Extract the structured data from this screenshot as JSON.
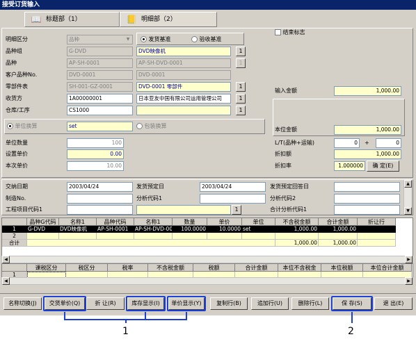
{
  "window": {
    "title": "接受订货输入"
  },
  "tabs": [
    {
      "label": "标题部（1）",
      "icon": "book-icon"
    },
    {
      "label": "明细部（2）",
      "icon": "notebook-icon"
    }
  ],
  "header": {
    "detail_type_label": "明细区分",
    "detail_type_value": "品种",
    "basis_option1": "发货基准",
    "basis_option2": "验收基准",
    "end_flag_label": "结束标志",
    "group_label": "品种组",
    "group_code": "G-DVD",
    "group_name": "DVD映像机",
    "item_label": "品种",
    "item_code": "AP-SH-0001",
    "item_name": "AP-SH-DVD-0001",
    "cust_item_label": "客户品种No.",
    "cust_item_code": "DVD-0001",
    "cust_item_name": "DVD-0001",
    "parts_label": "零部件表",
    "parts_code": "SH-001-GZ-0001",
    "parts_name": "DVD-0001 零部件",
    "receiver_label": "收货方",
    "receiver_code": "1A00000001",
    "receiver_name": "日本亚友中国有限公司运用管理公司",
    "warehouse_label": "仓库/工序",
    "warehouse_code": "CS1000",
    "warehouse_name": "",
    "input_amount_label": "输入金额",
    "input_amount": "1,000.00",
    "local_amount_label": "本位金额",
    "local_amount": "1,000.00",
    "unit_conv_label": "单位换算",
    "unit_conv_value": "set",
    "pack_conv_label": "包装换算",
    "unit_qty_label": "单位数量",
    "unit_qty": "100",
    "set_price_label": "设置单价",
    "set_price": "0.00",
    "this_price_label": "本次单价",
    "this_price": "10.00",
    "lt_label": "L/T(品种+运输)",
    "lt_value1": "0",
    "lt_plus": "+",
    "lt_value2": "0",
    "discount_label": "折扣额",
    "discount_value": "1,000.00",
    "discount_rate_label": "折扣率",
    "discount_rate_value": "1.000000",
    "confirm_button": "确 定(E)"
  },
  "delivery": {
    "delivery_date_label": "交纳日期",
    "delivery_date": "2003/04/24",
    "ship_date_label": "发货预定日",
    "ship_date": "2003/04/24",
    "ship_answer_label": "发货预定回答日",
    "ship_answer": "",
    "mfg_no_label": "制造No.",
    "mfg_no": "",
    "analysis1_label": "分析代码1",
    "analysis1": "",
    "analysis2_label": "分析代码2",
    "analysis2": "",
    "project_label": "工程项目代码1",
    "project": "",
    "project_name": "",
    "total_analysis_label": "合计分析代码1",
    "total_analysis": ""
  },
  "detail_grid": {
    "columns": [
      "品种G代码",
      "名称1",
      "品种代码",
      "名称1",
      "数量",
      "单价",
      "单位",
      "不含税金额",
      "合计金额",
      "折让行"
    ],
    "rows": [
      {
        "no": "1",
        "cells": [
          "G-DVD",
          "DVD映像机",
          "AP-SH-0001",
          "AP-SH-DVD-000",
          "100.0000",
          "10.0000",
          "set",
          "1,000.00",
          "1,000.00",
          ""
        ]
      },
      {
        "no": "2",
        "cells": [
          "",
          "",
          "",
          "",
          "",
          "",
          "",
          "",
          "",
          ""
        ]
      }
    ],
    "total_label": "合计",
    "total_excl": "1,000.00",
    "total_amount": "1,000.00"
  },
  "tax_grid": {
    "columns": [
      "课税区分",
      "税区分",
      "税率",
      "不含税金额",
      "税额",
      "合计金额",
      "本位不含税金",
      "本位税额",
      "本位合计金额"
    ],
    "rows": [
      {
        "no": "1",
        "cells": [
          "",
          "",
          "",
          "",
          "",
          "",
          "",
          "",
          ""
        ]
      }
    ]
  },
  "footer_buttons": [
    {
      "label": "名称切换(J)"
    },
    {
      "label": "交货单价(Q)"
    },
    {
      "label": "折 让(R)"
    },
    {
      "label": "库存显示(I)"
    },
    {
      "label": "单价显示(Y)"
    },
    {
      "label": "复制行(B)"
    },
    {
      "label": "追加行(U)"
    },
    {
      "label": "删除行(L)"
    },
    {
      "label": "保 存(S)"
    },
    {
      "label": "退 出(E)"
    }
  ],
  "callouts": {
    "c1": "1",
    "c2": "2"
  },
  "colors": {
    "highlight": "#1a3fd8",
    "title_bar": "#0a246a",
    "field_yellow": "#ffffcc"
  }
}
